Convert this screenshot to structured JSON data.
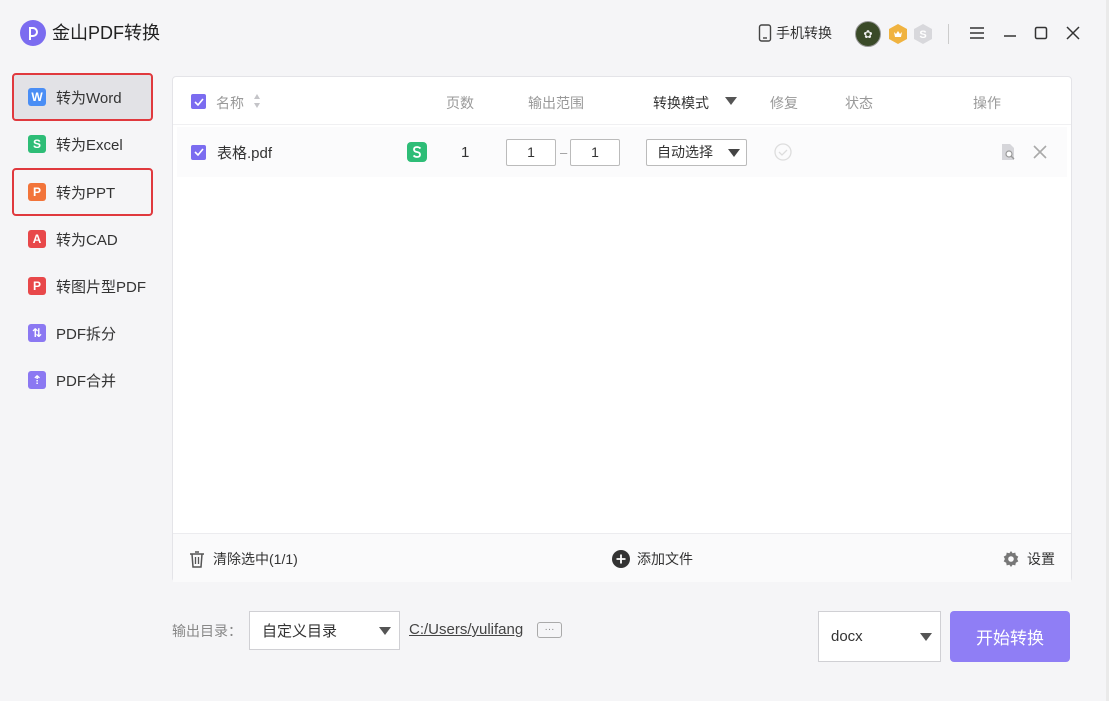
{
  "app": {
    "title": "金山PDF转换"
  },
  "titlebar": {
    "phone_convert": "手机转换",
    "avatar_text": "✿"
  },
  "sidebar": {
    "items": [
      {
        "label": "转为Word",
        "icon": "W",
        "color": "#4a8ef5"
      },
      {
        "label": "转为Excel",
        "icon": "S",
        "color": "#2ebd77"
      },
      {
        "label": "转为PPT",
        "icon": "P",
        "color": "#f2743a"
      },
      {
        "label": "转为CAD",
        "icon": "A",
        "color": "#e8484a"
      },
      {
        "label": "转图片型PDF",
        "icon": "P",
        "color": "#e8484a"
      },
      {
        "label": "PDF拆分",
        "icon": "⇅",
        "color": "#8b78f2"
      },
      {
        "label": "PDF合并",
        "icon": "⇡",
        "color": "#8b78f2"
      }
    ]
  },
  "table": {
    "headers": {
      "name": "名称",
      "pages": "页数",
      "range": "输出范围",
      "mode": "转换模式",
      "repair": "修复",
      "status": "状态",
      "actions": "操作"
    },
    "rows": [
      {
        "name": "表格.pdf",
        "pages": "1",
        "range_from": "1",
        "range_to": "1",
        "mode": "自动选择",
        "status": ""
      }
    ]
  },
  "panel_footer": {
    "clear": "清除选中(1/1)",
    "add_file": "添加文件",
    "settings": "设置"
  },
  "output": {
    "label": "输出目录：",
    "dir_option": "自定义目录",
    "path": "C:/Users/yulifang",
    "dots": "···",
    "format": "docx",
    "start_button": "开始转换"
  },
  "colors": {
    "accent": "#7b6cf0",
    "start_button": "#8f7ef5",
    "highlight_border": "#e0393e"
  }
}
